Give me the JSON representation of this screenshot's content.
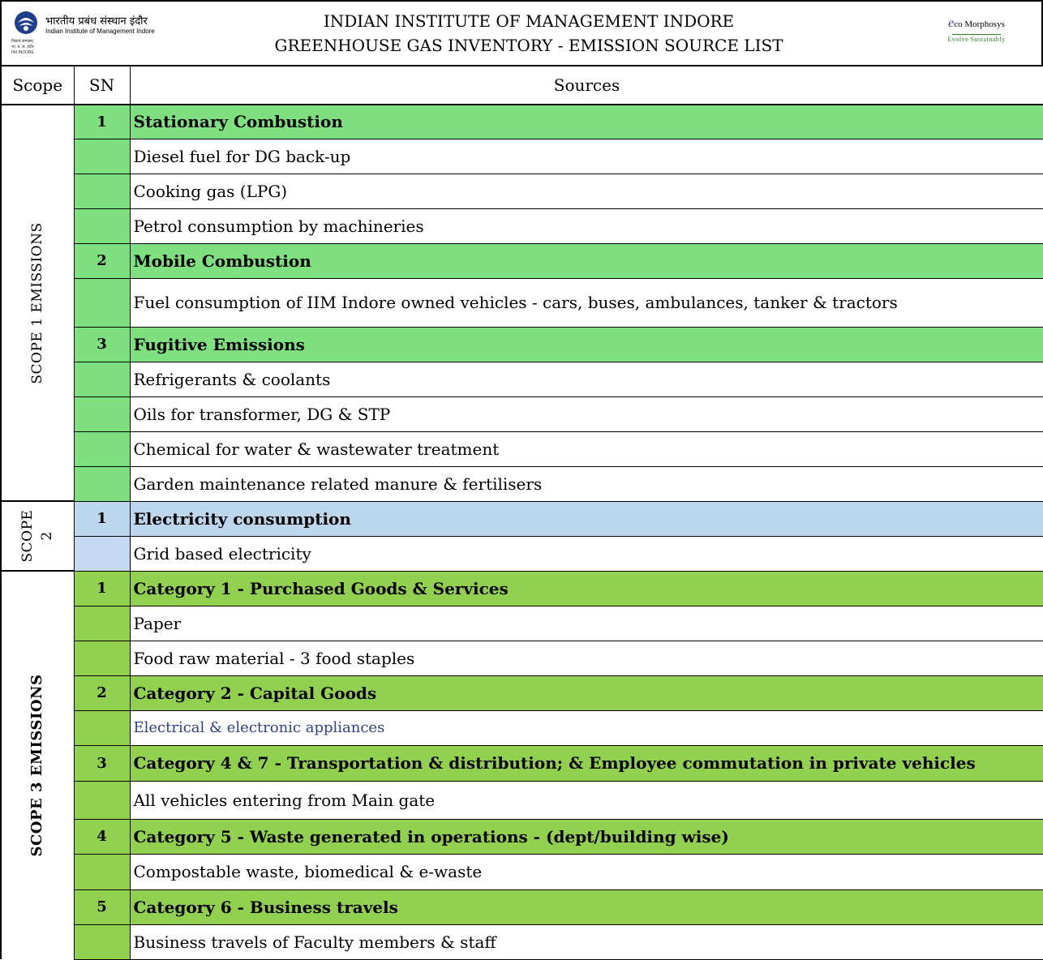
{
  "header": {
    "title_line1": "INDIAN INSTITUTE OF MANAGEMENT INDORE",
    "title_line2": "GREENHOUSE GAS INVENTORY - EMISSION SOURCE LIST",
    "logo_left": {
      "hindi": "भारतीय प्रबंध संस्थान इंदौर",
      "english": "Indian Institute of Management Indore",
      "tiny1": "विद्यार्थ सम्पन्नम्",
      "tiny2": "भा. प्र. सं. इंदौर",
      "tiny3": "IIM INDORE"
    },
    "logo_right": {
      "e": "e",
      "brand": "co Morphosys",
      "tagline": "Evolve Sustainably"
    }
  },
  "columns": {
    "scope": "Scope",
    "sn": "SN",
    "sources": "Sources"
  },
  "colors": {
    "scope1_green": "#7ee07e",
    "scope2_blue": "#bdd7ee",
    "scope3_green": "#92d050",
    "link_blue": "#2f3f8f"
  },
  "scopes": [
    {
      "label": "SCOPE 1 EMISSIONS",
      "rows": [
        {
          "sn": "1",
          "source": "Stationary Combustion",
          "type": "category"
        },
        {
          "sn": "",
          "source": "Diesel fuel for DG back-up",
          "type": "item"
        },
        {
          "sn": "",
          "source": "Cooking gas (LPG)",
          "type": "item"
        },
        {
          "sn": "",
          "source": "Petrol consumption by machineries",
          "type": "item"
        },
        {
          "sn": "2",
          "source": "Mobile Combustion",
          "type": "category"
        },
        {
          "sn": "",
          "source": "Fuel consumption of IIM Indore owned vehicles - cars, buses, ambulances, tanker & tractors",
          "type": "item"
        },
        {
          "sn": "3",
          "source": "Fugitive Emissions",
          "type": "category"
        },
        {
          "sn": "",
          "source": "Refrigerants & coolants",
          "type": "item"
        },
        {
          "sn": "",
          "source": "Oils for transformer, DG & STP",
          "type": "item"
        },
        {
          "sn": "",
          "source": "Chemical for water & wastewater treatment",
          "type": "item"
        },
        {
          "sn": "",
          "source": "Garden maintenance related manure & fertilisers",
          "type": "item"
        }
      ]
    },
    {
      "label_line1": "SCOPE",
      "label_line2": "2",
      "rows": [
        {
          "sn": "1",
          "source": "Electricity consumption",
          "type": "category"
        },
        {
          "sn": "",
          "source": "Grid based electricity",
          "type": "item"
        }
      ]
    },
    {
      "label": "SCOPE 3 EMISSIONS",
      "rows": [
        {
          "sn": "1",
          "source": "Category 1 - Purchased Goods & Services",
          "type": "category"
        },
        {
          "sn": "",
          "source": "Paper",
          "type": "item"
        },
        {
          "sn": "",
          "source": "Food raw material - 3 food staples",
          "type": "item"
        },
        {
          "sn": "2",
          "source": "Category 2 - Capital Goods",
          "type": "category"
        },
        {
          "sn": "",
          "source": "Electrical & electronic appliances",
          "type": "item"
        },
        {
          "sn": "3",
          "source": "Category 4 & 7 - Transportation & distribution; & Employee commutation in private vehicles",
          "type": "category"
        },
        {
          "sn": "",
          "source": "All vehicles entering from Main gate",
          "type": "item"
        },
        {
          "sn": "4",
          "source": "Category 5 - Waste generated in operations - (dept/building wise)",
          "type": "category"
        },
        {
          "sn": "",
          "source": "Compostable waste, biomedical & e-waste",
          "type": "item"
        },
        {
          "sn": "5",
          "source": "Category 6 - Business travels",
          "type": "category"
        },
        {
          "sn": "",
          "source": "Business travels of Faculty members & staff",
          "type": "item"
        }
      ]
    }
  ]
}
